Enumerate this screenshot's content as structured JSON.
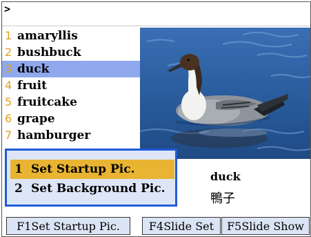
{
  "input": {
    "prompt": ">"
  },
  "word_list": {
    "items": [
      {
        "num": "1",
        "word": "amaryllis"
      },
      {
        "num": "2",
        "word": "bushbuck"
      },
      {
        "num": "3",
        "word": "duck"
      },
      {
        "num": "4",
        "word": "fruit"
      },
      {
        "num": "5",
        "word": "fruitcake"
      },
      {
        "num": "6",
        "word": "grape"
      },
      {
        "num": "7",
        "word": "hamburger"
      }
    ],
    "selected_index": 2
  },
  "detail": {
    "word": "duck",
    "translation": "鴨子"
  },
  "popup_menu": {
    "items": [
      {
        "num": "1",
        "label": "Set Startup Pic."
      },
      {
        "num": "2",
        "label": "Set Background Pic."
      }
    ],
    "selected_index": 0
  },
  "function_keys": {
    "f1": "F1Set Startup Pic.",
    "f4": "F4Slide Set",
    "f5": "F5Slide Show"
  },
  "colors": {
    "list_number": "#e0a020",
    "list_selection": "#8fa8ee",
    "popup_border": "#1f5bd6",
    "popup_selection": "#e8b432",
    "fkey_background": "#dbe4f4"
  }
}
